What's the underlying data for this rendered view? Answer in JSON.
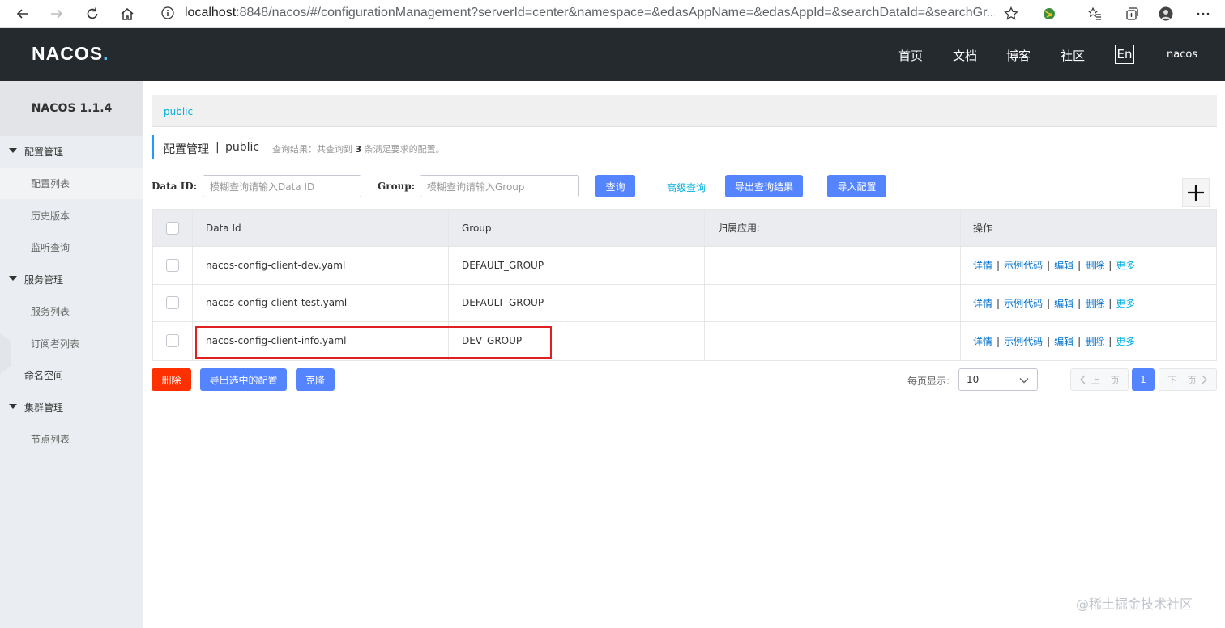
{
  "browser": {
    "url_host": "localhost",
    "url_rest": ":8848/nacos/#/configurationManagement?serverId=center&namespace=&edasAppName=&edasAppId=&searchDataId=&searchGr..."
  },
  "header": {
    "logo_text": "NACOS",
    "logo_dot": ".",
    "nav": [
      "首页",
      "文档",
      "博客",
      "社区"
    ],
    "lang": "En",
    "user": "nacos"
  },
  "sidebar": {
    "title": "NACOS 1.1.4",
    "groups": [
      {
        "label": "配置管理",
        "items": [
          "配置列表",
          "历史版本",
          "监听查询"
        ]
      },
      {
        "label": "服务管理",
        "items": [
          "服务列表",
          "订阅者列表"
        ]
      },
      {
        "label": "命名空间",
        "items": []
      },
      {
        "label": "集群管理",
        "items": [
          "节点列表"
        ]
      }
    ]
  },
  "breadcrumb": {
    "link": "public"
  },
  "page": {
    "title": "配置管理",
    "separator": "|",
    "namespace": "public",
    "query_result_prefix": "查询结果：共查询到",
    "query_result_count": "3",
    "query_result_suffix": "条满足要求的配置。"
  },
  "search": {
    "dataid_label": "Data ID:",
    "dataid_placeholder": "模糊查询请输入Data ID",
    "group_label": "Group:",
    "group_placeholder": "模糊查询请输入Group",
    "query_button": "查询",
    "advanced_link": "高级查询",
    "export_button": "导出查询结果",
    "import_button": "导入配置"
  },
  "table": {
    "columns": [
      "Data Id",
      "Group",
      "归属应用:",
      "操作"
    ],
    "rows": [
      {
        "data_id": "nacos-config-client-dev.yaml",
        "group": "DEFAULT_GROUP",
        "app": ""
      },
      {
        "data_id": "nacos-config-client-test.yaml",
        "group": "DEFAULT_GROUP",
        "app": ""
      },
      {
        "data_id": "nacos-config-client-info.yaml",
        "group": "DEV_GROUP",
        "app": ""
      }
    ],
    "operations": [
      "详情",
      "示例代码",
      "编辑",
      "删除",
      "更多"
    ],
    "op_separator": "|"
  },
  "footer": {
    "delete_button": "删除",
    "export_selected_button": "导出选中的配置",
    "clone_button": "克隆",
    "per_page_label": "每页显示:",
    "per_page_value": "10",
    "prev_label": "上一页",
    "current_page": "1",
    "next_label": "下一页"
  },
  "watermark": "@稀土掘金技术社区",
  "colors": {
    "header_bg": "#252a2f",
    "primary": "#5584ff",
    "danger": "#ff3000",
    "link": "#00b0e0",
    "op_link": "#0070cc",
    "highlight": "#e02020"
  }
}
